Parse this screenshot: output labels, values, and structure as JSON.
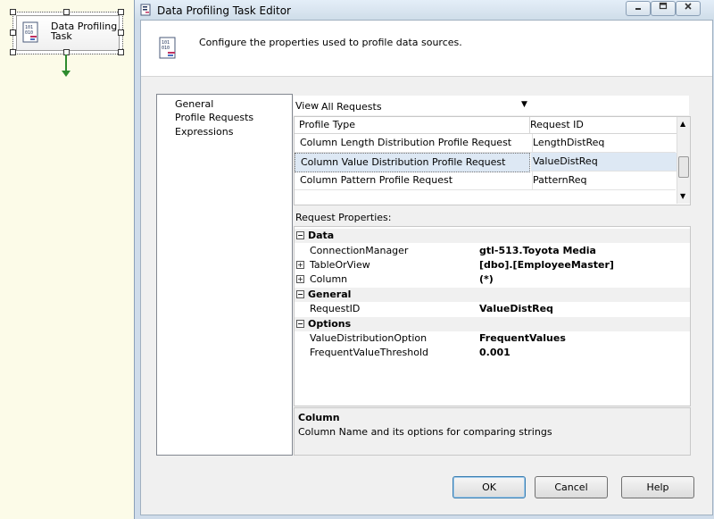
{
  "canvas": {
    "task_label": "Data Profiling Task"
  },
  "dialog": {
    "title": "Data Profiling Task Editor",
    "header_text": "Configure the properties used to profile data sources.",
    "nav": [
      "General",
      "Profile Requests",
      "Expressions"
    ],
    "selected_nav": "Profile Requests",
    "view_label": "View",
    "view_value": "All Requests",
    "grid": {
      "columns": [
        "Profile Type",
        "Request ID"
      ],
      "rows": [
        {
          "type": "Column Length Distribution Profile Request",
          "id": "LengthDistReq"
        },
        {
          "type": "Column Value Distribution Profile Request",
          "id": "ValueDistReq",
          "selected": true
        },
        {
          "type": "Column Pattern Profile Request",
          "id": "PatternReq"
        }
      ]
    },
    "properties_title": "Request Properties:",
    "properties": {
      "cat_data": "Data",
      "connection_manager_name": "ConnectionManager",
      "connection_manager_value": "gtl-513.Toyota Media",
      "table_or_view_name": "TableOrView",
      "table_or_view_value": "[dbo].[EmployeeMaster]",
      "column_name": "Column",
      "column_value": "(*)",
      "cat_general": "General",
      "request_id_name": "RequestID",
      "request_id_value": "ValueDistReq",
      "cat_options": "Options",
      "vdo_name": "ValueDistributionOption",
      "vdo_value": "FrequentValues",
      "fvt_name": "FrequentValueThreshold",
      "fvt_value": "0.001"
    },
    "description": {
      "title": "Column",
      "text": "Column Name and its options for comparing strings"
    },
    "buttons": {
      "ok": "OK",
      "cancel": "Cancel",
      "help": "Help"
    }
  },
  "colors": {
    "selection": "#dde8f4",
    "accent": "#3c7fb1"
  }
}
